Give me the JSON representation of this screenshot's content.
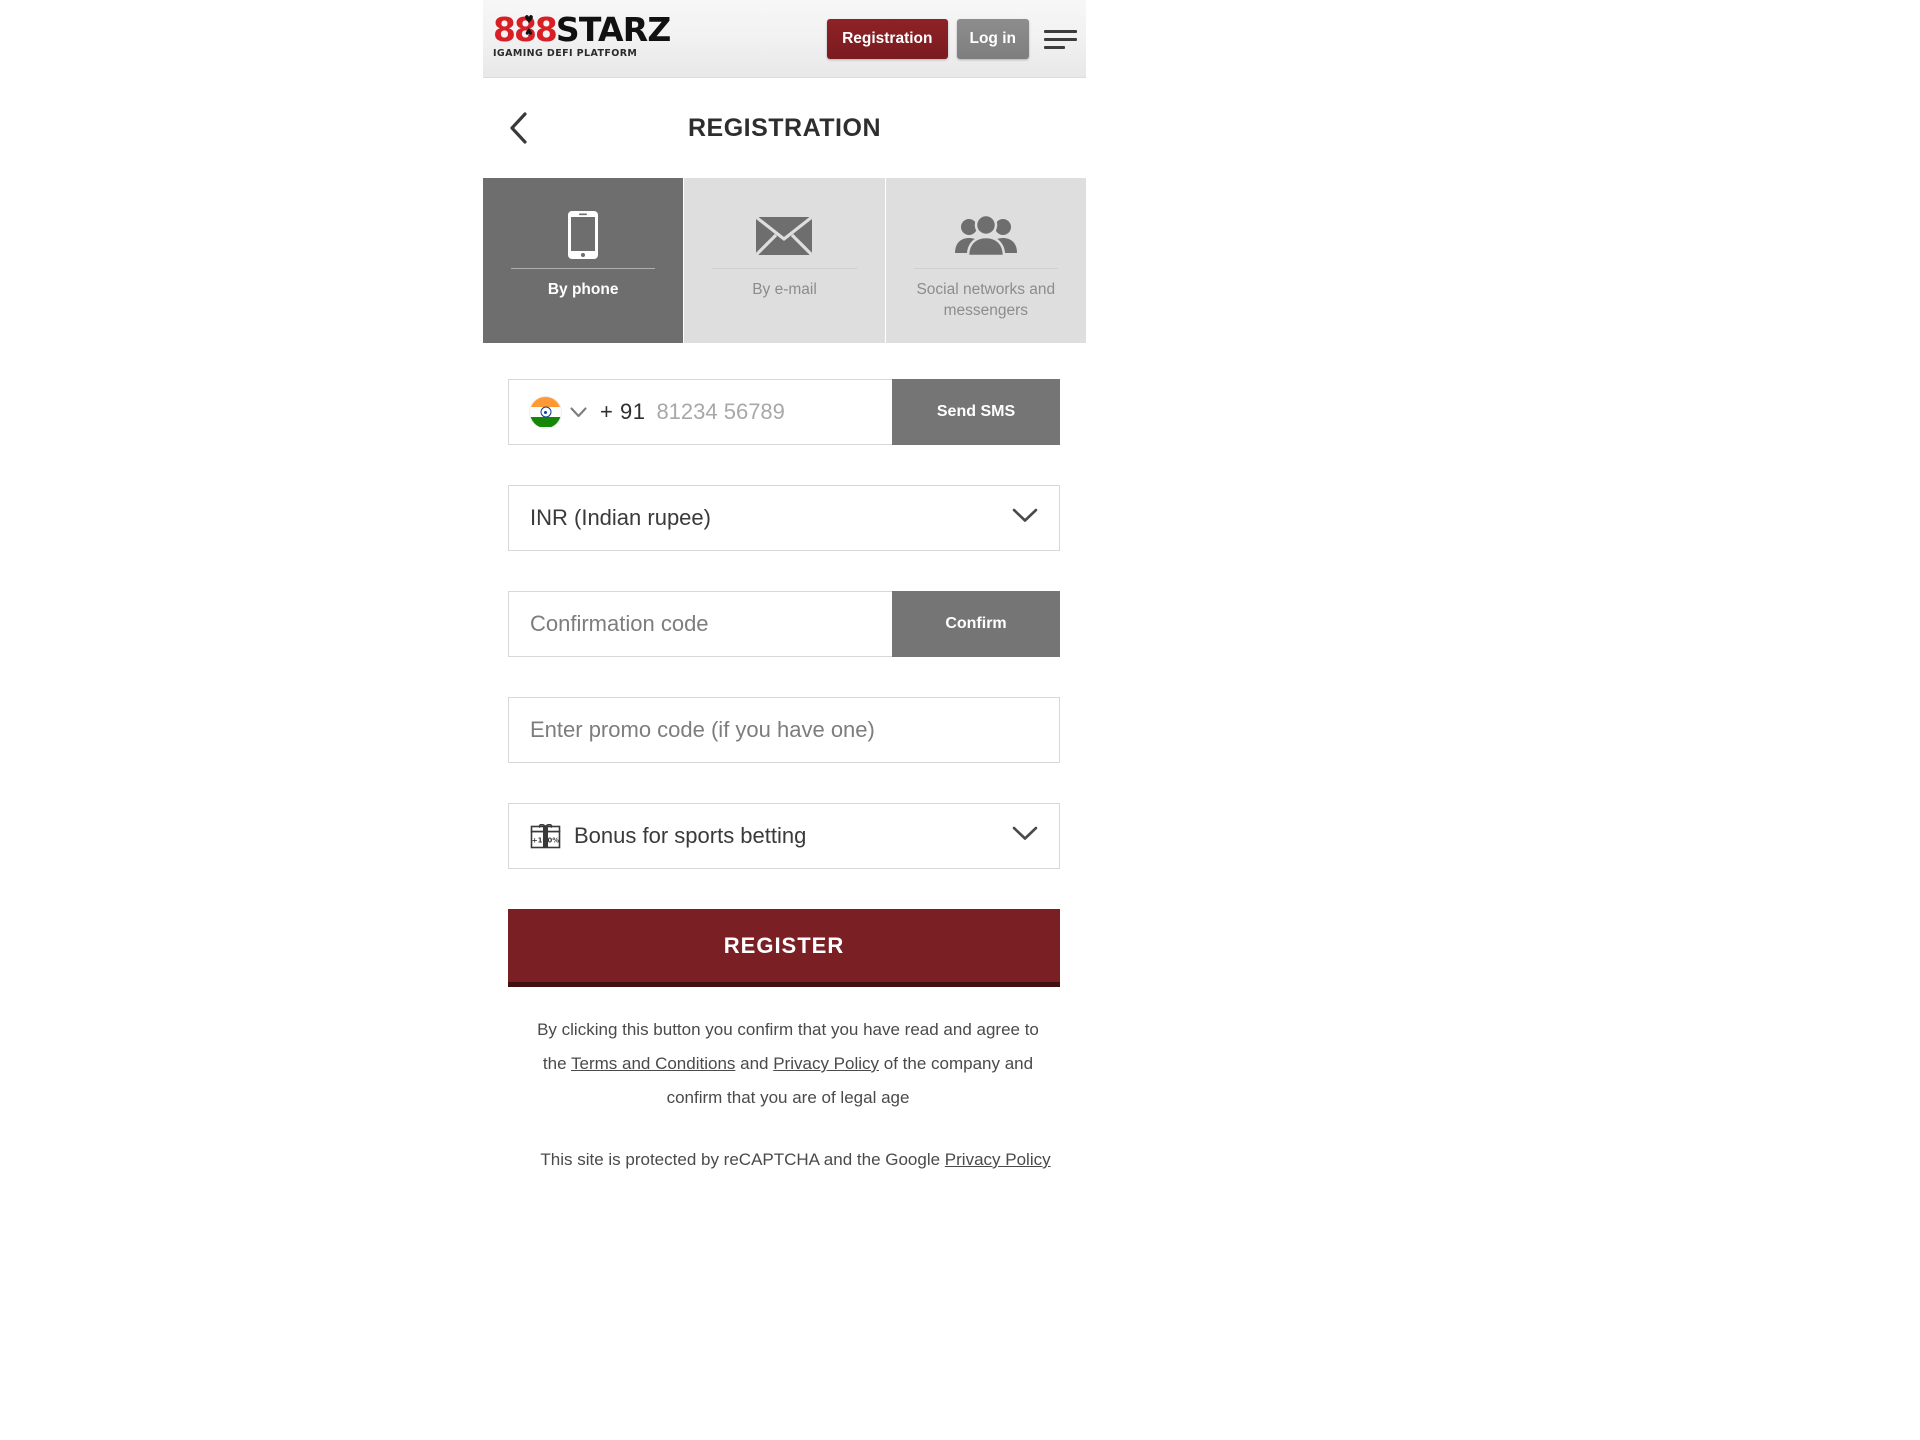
{
  "header": {
    "logo": {
      "digits": "888",
      "word": "STARZ",
      "suit_top": "♥",
      "suit_bottom": "♠",
      "tagline": "iGaming DeFi Platform"
    },
    "registration_label": "Registration",
    "login_label": "Log in",
    "menu_icon": "hamburger-menu-icon",
    "accent_red": "#7a1b20",
    "gray_button": "#7e7e7e"
  },
  "titlebar": {
    "back_icon": "chevron-left-icon",
    "title": "REGISTRATION"
  },
  "tabs": [
    {
      "label": "By phone",
      "icon": "mobile-phone-icon",
      "active": true
    },
    {
      "label": "By e-mail",
      "icon": "envelope-icon",
      "active": false
    },
    {
      "label": "Social networks and messengers",
      "icon": "people-group-icon",
      "active": false
    }
  ],
  "form": {
    "phone": {
      "flag_icon": "india-flag-icon",
      "country_chevron": "chevron-down-icon",
      "dial_code": "+ 91",
      "placeholder": "81234 56789",
      "value": "",
      "send_sms_label": "Send SMS"
    },
    "currency": {
      "value": "INR (Indian rupee)",
      "chevron": "chevron-down-icon"
    },
    "confirmation": {
      "placeholder": "Confirmation code",
      "value": "",
      "confirm_label": "Confirm"
    },
    "promo": {
      "placeholder": "Enter promo code (if you have one)",
      "value": ""
    },
    "bonus": {
      "icon": "gift-box-icon",
      "icon_text": "+100%",
      "value": "Bonus for sports betting",
      "chevron": "chevron-down-icon"
    },
    "register_label": "REGISTER"
  },
  "legal": {
    "line1": "By clicking this button you confirm that you have read and agree to",
    "line2_prefix": "the ",
    "terms_link": "Terms and Conditions",
    "line2_mid": " and ",
    "privacy_link": "Privacy Policy",
    "line2_suffix": " of the company and",
    "line3": "confirm that you are of legal age",
    "recaptcha_prefix": "This site is protected by reCAPTCHA and the Google ",
    "recaptcha_link": "Privacy Policy"
  }
}
